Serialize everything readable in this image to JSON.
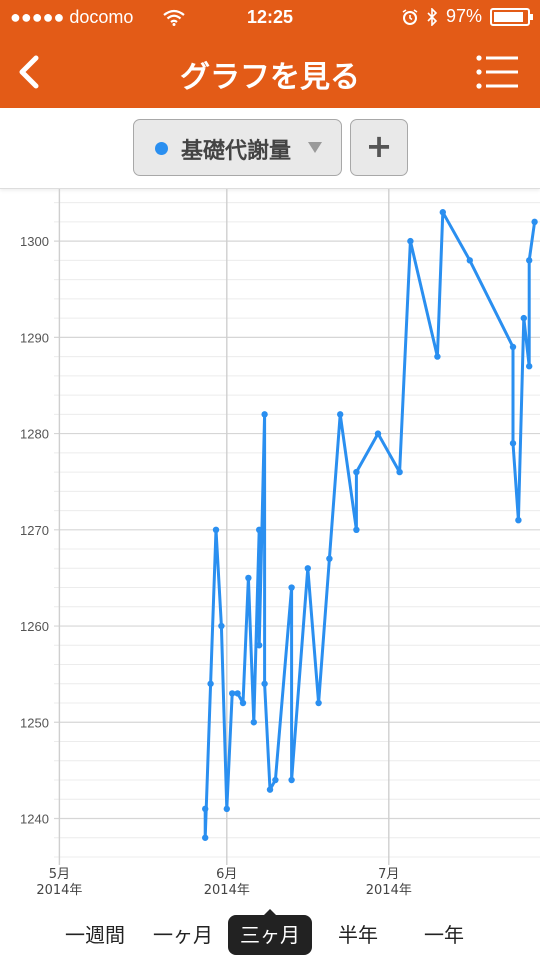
{
  "status_bar": {
    "carrier": "●●●●● docomo",
    "time": "12:25",
    "battery_text": "97%",
    "battery_level": 0.97
  },
  "nav": {
    "title": "グラフを見る"
  },
  "selector": {
    "label": "基礎代謝量",
    "dot_color": "#2a8ff0"
  },
  "add_label": "+",
  "colors": {
    "accent": "#e35b17",
    "series": "#2a8ff0"
  },
  "chart_data": {
    "type": "line",
    "title": "",
    "xlabel": "",
    "ylabel": "",
    "ylim": [
      1236,
      1305
    ],
    "yticks": [
      1240,
      1250,
      1260,
      1270,
      1280,
      1290,
      1300
    ],
    "xlim": [
      "2014-04-30",
      "2014-07-29"
    ],
    "xticks": [
      {
        "date": "2014-05-01",
        "month": "5月",
        "year": "2014年"
      },
      {
        "date": "2014-06-01",
        "month": "6月",
        "year": "2014年"
      },
      {
        "date": "2014-07-01",
        "month": "7月",
        "year": "2014年"
      }
    ],
    "grid": true,
    "series": [
      {
        "color": "#2a8ff0",
        "points": [
          [
            "2014-05-28",
            1241
          ],
          [
            "2014-05-28",
            1238
          ],
          [
            "2014-05-29",
            1254
          ],
          [
            "2014-05-30",
            1270
          ],
          [
            "2014-05-31",
            1260
          ],
          [
            "2014-06-01",
            1241
          ],
          [
            "2014-06-02",
            1253
          ],
          [
            "2014-06-03",
            1253
          ],
          [
            "2014-06-04",
            1252
          ],
          [
            "2014-06-05",
            1265
          ],
          [
            "2014-06-06",
            1250
          ],
          [
            "2014-06-07",
            1270
          ],
          [
            "2014-06-07",
            1258
          ],
          [
            "2014-06-08",
            1282
          ],
          [
            "2014-06-08",
            1254
          ],
          [
            "2014-06-09",
            1243
          ],
          [
            "2014-06-10",
            1244
          ],
          [
            "2014-06-13",
            1264
          ],
          [
            "2014-06-13",
            1244
          ],
          [
            "2014-06-16",
            1266
          ],
          [
            "2014-06-18",
            1252
          ],
          [
            "2014-06-20",
            1267
          ],
          [
            "2014-06-22",
            1282
          ],
          [
            "2014-06-25",
            1270
          ],
          [
            "2014-06-25",
            1276
          ],
          [
            "2014-06-29",
            1280
          ],
          [
            "2014-07-03",
            1276
          ],
          [
            "2014-07-05",
            1300
          ],
          [
            "2014-07-10",
            1288
          ],
          [
            "2014-07-11",
            1303
          ],
          [
            "2014-07-16",
            1298
          ],
          [
            "2014-07-24",
            1289
          ],
          [
            "2014-07-24",
            1279
          ],
          [
            "2014-07-25",
            1271
          ],
          [
            "2014-07-26",
            1292
          ],
          [
            "2014-07-27",
            1287
          ],
          [
            "2014-07-27",
            1298
          ],
          [
            "2014-07-28",
            1302
          ]
        ]
      }
    ]
  },
  "ranges": [
    {
      "label": "一週間",
      "selected": false
    },
    {
      "label": "一ヶ月",
      "selected": false
    },
    {
      "label": "三ヶ月",
      "selected": true
    },
    {
      "label": "半年",
      "selected": false
    },
    {
      "label": "一年",
      "selected": false
    }
  ]
}
